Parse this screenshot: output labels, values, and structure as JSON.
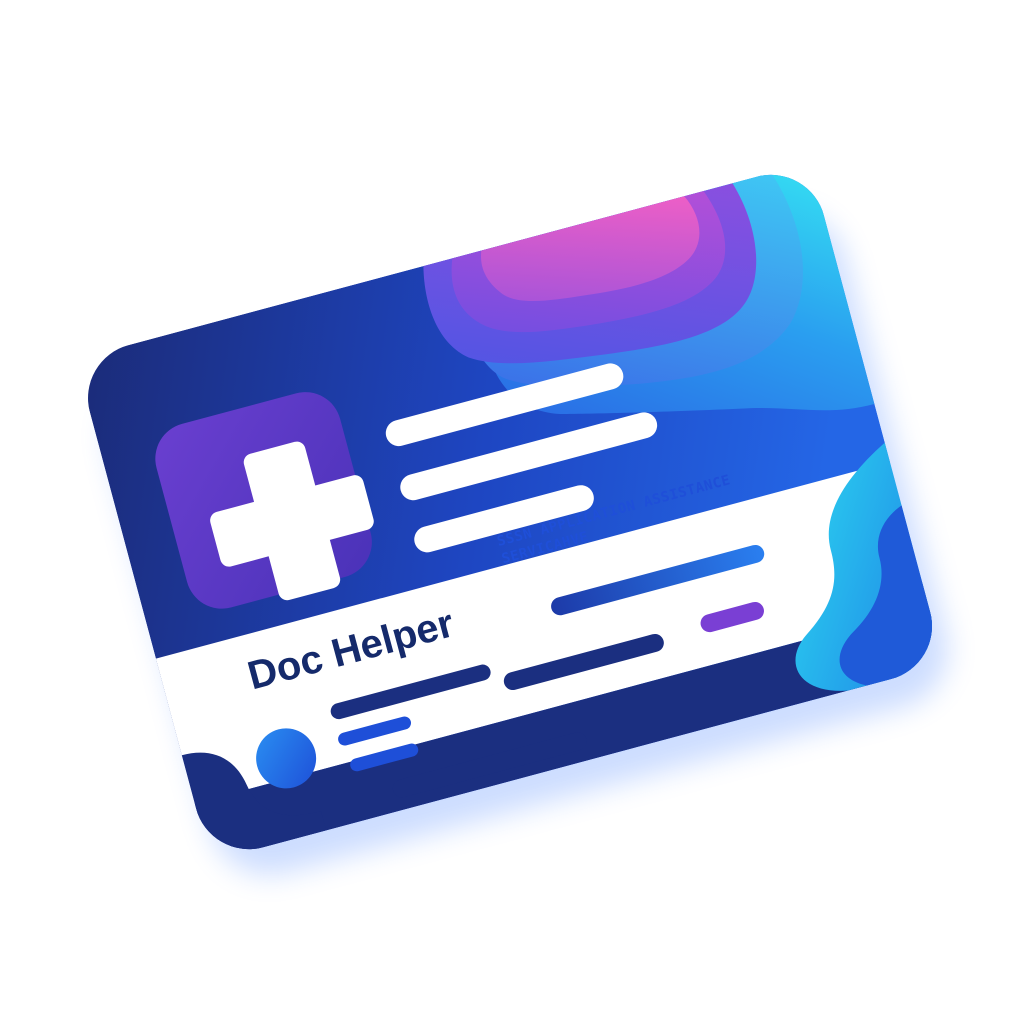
{
  "card": {
    "title": "Doc  Helper",
    "tagline_line1": "SSSN APPLICATION ASSISTANCE",
    "tagline_line2": "SERVICAHVE"
  },
  "icons": {
    "logo": "plus-icon",
    "avatar": "avatar-circle"
  },
  "colors": {
    "background": "#ffffff",
    "card_navy": "#1a2f7e",
    "card_blue": "#1f58d8",
    "accent_cyan": "#2fd6ef",
    "accent_pink": "#f060c8",
    "accent_purple": "#7a3fd4",
    "title_text": "#152a6b",
    "tagline_text": "#1f4fd8"
  }
}
